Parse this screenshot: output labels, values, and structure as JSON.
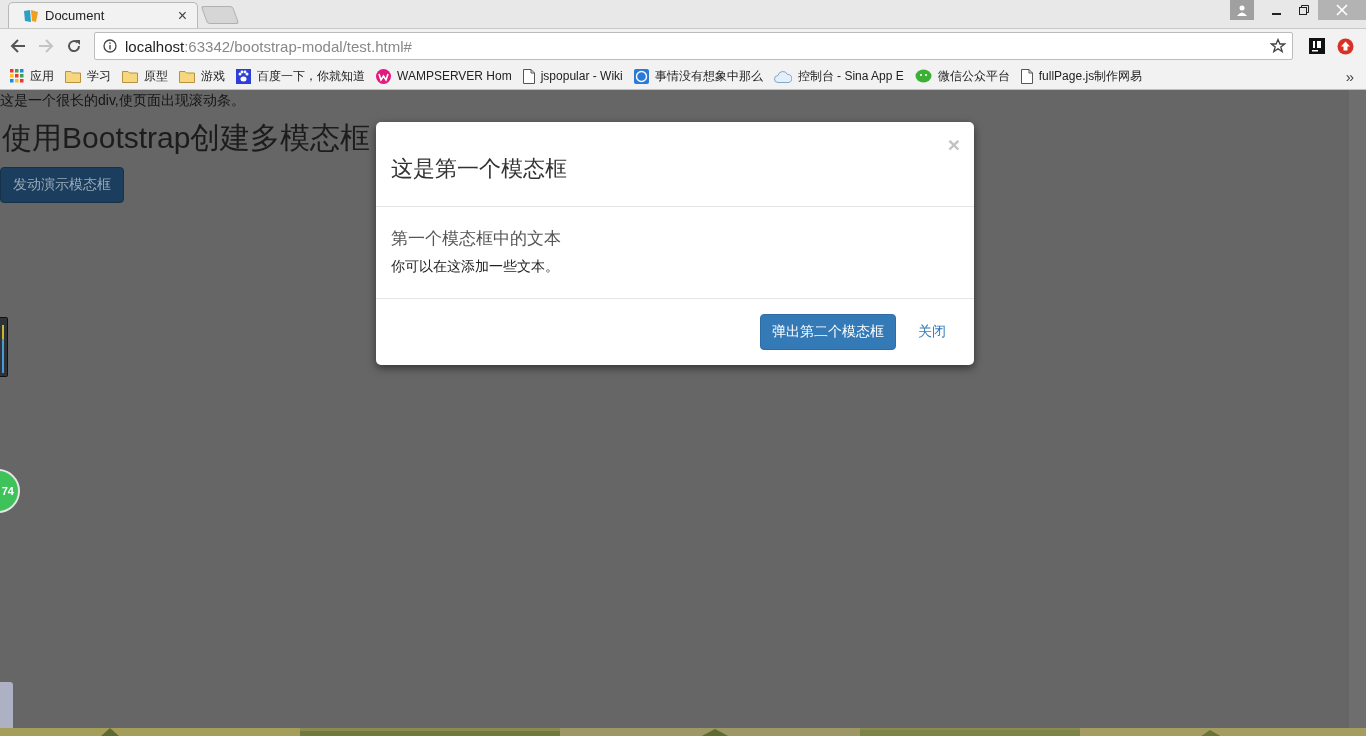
{
  "browser": {
    "tab": {
      "title": "Document",
      "close": "×"
    },
    "nav": {
      "back_disabled": false,
      "forward_disabled": true
    },
    "address": {
      "host": "localhost",
      "path": ":63342/bootstrap-modal/test.html#"
    },
    "bookmarks": [
      {
        "kind": "apps",
        "label": "应用"
      },
      {
        "kind": "folder",
        "label": "学习"
      },
      {
        "kind": "folder",
        "label": "原型"
      },
      {
        "kind": "folder",
        "label": "游戏"
      },
      {
        "kind": "paw",
        "label": "百度一下，你就知道"
      },
      {
        "kind": "wamp",
        "label": "WAMPSERVER Hom"
      },
      {
        "kind": "page",
        "label": "jspopular - Wiki"
      },
      {
        "kind": "badge",
        "label": "事情没有想象中那么"
      },
      {
        "kind": "cloud",
        "label": "控制台 - Sina App E"
      },
      {
        "kind": "chat",
        "label": "微信公众平台"
      },
      {
        "kind": "page",
        "label": "fullPage.js制作网易"
      }
    ],
    "overflow": "»"
  },
  "page": {
    "intro": "这是一个很长的div,使页面出现滚动条。",
    "heading": "使用Bootstrap创建多模态框",
    "launch_button": "发动演示模态框"
  },
  "modal": {
    "close": "×",
    "title": "这是第一个模态框",
    "subtitle": "第一个模态框中的文本",
    "text": "你可以在这添加一些文本。",
    "primary_button": "弹出第二个模态框",
    "close_link": "关闭"
  },
  "speed_ball": "74"
}
